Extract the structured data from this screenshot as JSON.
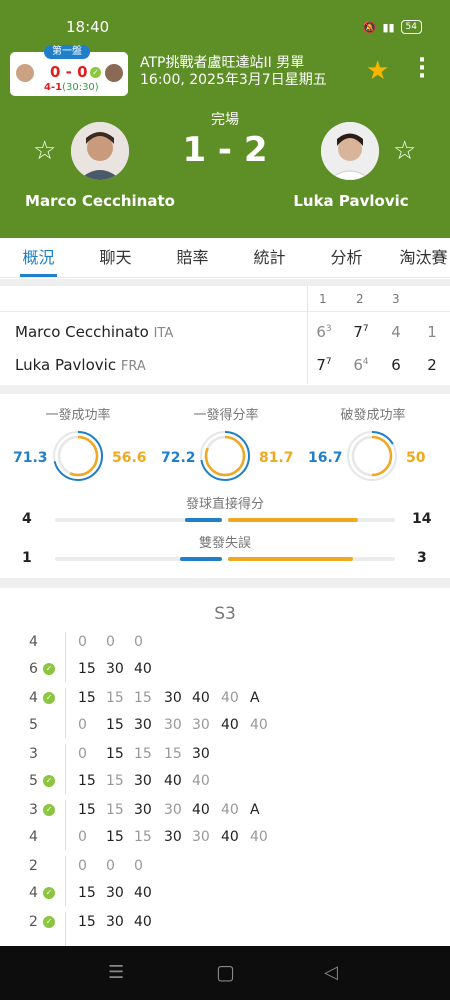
{
  "status_bar": {
    "time": "18:40",
    "battery": "54"
  },
  "mini_score": {
    "tag": "第一盤",
    "score": "0 - 0",
    "game": "4-1",
    "point": "(30:30)"
  },
  "match": {
    "tournament": "ATP挑戰者盧旺達站II 男單",
    "datetime": "16:00, 2025年3月7日星期五",
    "status": "完場",
    "score": "1 - 2"
  },
  "players": [
    {
      "name": "Marco Cecchinato",
      "country": "ITA"
    },
    {
      "name": "Luka Pavlovic",
      "country": "FRA"
    }
  ],
  "tabs": [
    "概況",
    "聊天",
    "賠率",
    "統計",
    "分析",
    "淘汰賽"
  ],
  "set_headers": [
    "1",
    "2",
    "3"
  ],
  "sets": {
    "p1": [
      {
        "v": "6",
        "tb": "3"
      },
      {
        "v": "7",
        "tb": "7"
      },
      {
        "v": "4",
        "tb": ""
      }
    ],
    "p2": [
      {
        "v": "7",
        "tb": "7"
      },
      {
        "v": "6",
        "tb": "4"
      },
      {
        "v": "6",
        "tb": ""
      }
    ],
    "current": {
      "p1": "1",
      "p2": "2"
    }
  },
  "stats": {
    "first_serve_in": {
      "label": "一發成功率",
      "p1": "71.3",
      "p2": "56.6",
      "p1_pct": 71.3,
      "p2_pct": 56.6
    },
    "first_serve_won": {
      "label": "一發得分率",
      "p1": "72.2",
      "p2": "81.7",
      "p1_pct": 72.2,
      "p2_pct": 81.7
    },
    "break_points": {
      "label": "破發成功率",
      "p1": "16.7",
      "p2": "50",
      "p1_pct": 16.7,
      "p2_pct": 50
    },
    "aces": {
      "label": "發球直接得分",
      "p1": "4",
      "p2": "14"
    },
    "double_faults": {
      "label": "雙發失誤",
      "p1": "1",
      "p2": "3"
    }
  },
  "pbp": {
    "title": "S3",
    "games": [
      {
        "top": "4",
        "bottom": "6",
        "server": "bottom",
        "a": [
          "0",
          "0",
          "0"
        ],
        "b": [
          "15",
          "30",
          "40"
        ]
      },
      {
        "top": "4",
        "bottom": "5",
        "server": "top",
        "a": [
          "15",
          "15",
          "15",
          "30",
          "40",
          "40",
          "A"
        ],
        "b": [
          "0",
          "15",
          "30",
          "30",
          "30",
          "40",
          "40"
        ]
      },
      {
        "top": "3",
        "bottom": "5",
        "server": "bottom",
        "a": [
          "0",
          "15",
          "15",
          "15",
          "30"
        ],
        "b": [
          "15",
          "15",
          "30",
          "40",
          "40"
        ]
      },
      {
        "top": "3",
        "bottom": "4",
        "server": "top",
        "a": [
          "15",
          "15",
          "30",
          "30",
          "40",
          "40",
          "A"
        ],
        "b": [
          "0",
          "15",
          "15",
          "30",
          "30",
          "40",
          "40"
        ]
      },
      {
        "top": "2",
        "bottom": "4",
        "server": "bottom",
        "a": [
          "0",
          "0",
          "0"
        ],
        "b": [
          "15",
          "30",
          "40"
        ]
      },
      {
        "top": "2",
        "bottom": "",
        "server": "top",
        "a": [
          "15",
          "30",
          "40"
        ],
        "b": []
      }
    ]
  },
  "colors": {
    "header": "#5d8f26",
    "blue": "#1f7fc8",
    "orange": "#f0a820",
    "green_check": "#8cc63f",
    "star": "#f7b500"
  }
}
